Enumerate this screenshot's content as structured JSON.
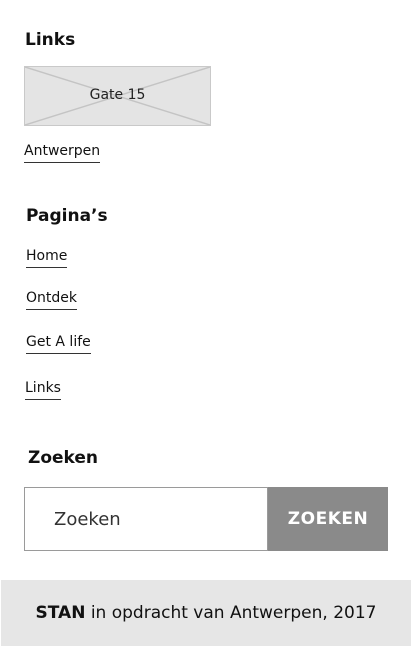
{
  "links_section": {
    "title": "Links",
    "image_label": "Gate 15",
    "link": "Antwerpen"
  },
  "pages_section": {
    "title": "Pagina’s",
    "items": [
      "Home",
      "Ontdek",
      "Get A life",
      "Links"
    ]
  },
  "search_section": {
    "title": "Zoeken",
    "placeholder": "Zoeken",
    "button_label": "ZOEKEN"
  },
  "footer": {
    "brand": "STAN",
    "text": " in opdracht van Antwerpen, 2017"
  },
  "colors": {
    "footer_bg": "#e6e6e6",
    "button_bg": "#8a8a8a",
    "image_placeholder_bg": "#e4e4e4"
  }
}
